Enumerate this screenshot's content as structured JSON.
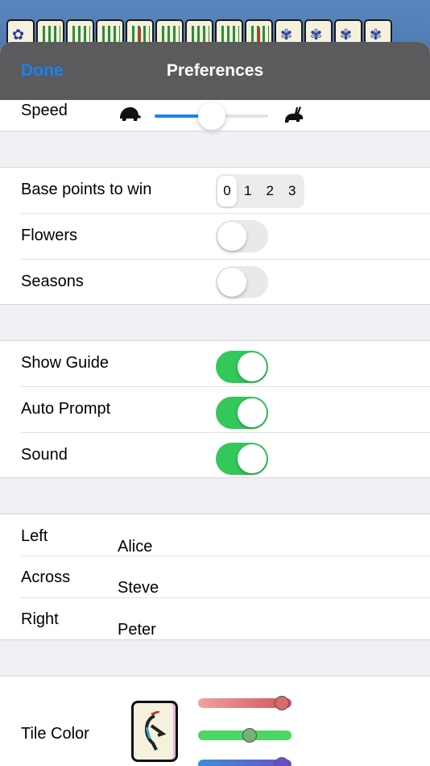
{
  "nav": {
    "done_label": "Done",
    "title": "Preferences"
  },
  "speed": {
    "label": "Speed",
    "value": 0.5,
    "slow_icon": "turtle-icon",
    "fast_icon": "rabbit-icon"
  },
  "game_rules": {
    "base_points": {
      "label": "Base points to win",
      "options": [
        "0",
        "1",
        "2",
        "3"
      ],
      "selected": "0"
    },
    "flowers": {
      "label": "Flowers",
      "on": false
    },
    "seasons": {
      "label": "Seasons",
      "on": false
    }
  },
  "helpers": {
    "show_guide": {
      "label": "Show Guide",
      "on": true
    },
    "auto_prompt": {
      "label": "Auto Prompt",
      "on": true
    },
    "sound": {
      "label": "Sound",
      "on": true
    }
  },
  "players": [
    {
      "position": "Left",
      "name": "Alice"
    },
    {
      "position": "Across",
      "name": "Steve"
    },
    {
      "position": "Right",
      "name": "Peter"
    }
  ],
  "tile_color": {
    "label": "Tile Color",
    "red": 0.9,
    "green": 0.55,
    "blue": 0.9
  },
  "colors": {
    "accent": "#1a82f0",
    "switch_on": "#34c759",
    "switch_off": "#e9e9ea",
    "nav_bg": "#5b5b5e"
  }
}
